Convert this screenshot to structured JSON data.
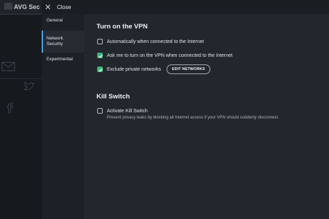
{
  "background_app": {
    "logo_text": "AVG Sec"
  },
  "top_bar": {
    "close_label": "Close"
  },
  "sidebar": {
    "items": [
      {
        "label": "General"
      },
      {
        "label_line1": "Network",
        "label_line2": "Security"
      },
      {
        "label": "Experimental"
      }
    ]
  },
  "vpn": {
    "title": "Turn on the VPN",
    "options": [
      {
        "label": "Automatically when connected to the Internet",
        "checked": false
      },
      {
        "label": "Ask me to turn on the VPN when connected to the Internet",
        "checked": true
      },
      {
        "label": "Exclude private networks",
        "checked": true
      }
    ],
    "edit_networks_label": "EDIT NETWORKS"
  },
  "kill_switch": {
    "title": "Kill Switch",
    "option_label": "Activate Kill Switch",
    "checked": false,
    "description": "Prevent privacy leaks by blocking all Internet access if your VPN should suddenly disconnect."
  },
  "colors": {
    "accent_green": "#3fb57a",
    "active_indicator": "#4aa3df",
    "panel_background": "#22262d"
  }
}
